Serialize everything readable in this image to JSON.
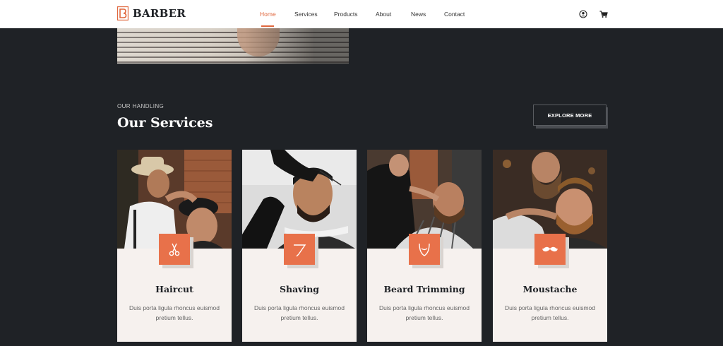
{
  "brand": {
    "name": "BARBER",
    "accent": "#e0673d"
  },
  "nav": {
    "items": [
      {
        "label": "Home",
        "active": true
      },
      {
        "label": "Services",
        "active": false
      },
      {
        "label": "Products",
        "active": false
      },
      {
        "label": "About",
        "active": false
      },
      {
        "label": "News",
        "active": false
      },
      {
        "label": "Contact",
        "active": false
      }
    ],
    "icons": [
      "user-icon",
      "cart-icon"
    ]
  },
  "services": {
    "eyebrow": "OUR HANDLING",
    "title": "Our Services",
    "explore_label": "EXPLORE MORE",
    "cards": [
      {
        "title": "Haircut",
        "desc": "Duis porta ligula rhoncus euismod pretium tellus.",
        "icon": "scissors-icon"
      },
      {
        "title": "Shaving",
        "desc": "Duis porta ligula rhoncus euismod pretium tellus.",
        "icon": "razor-icon"
      },
      {
        "title": "Beard Trimming",
        "desc": "Duis porta ligula rhoncus euismod pretium tellus.",
        "icon": "beard-icon"
      },
      {
        "title": "Moustache",
        "desc": "Duis porta ligula rhoncus euismod pretium tellus.",
        "icon": "moustache-icon"
      }
    ]
  }
}
